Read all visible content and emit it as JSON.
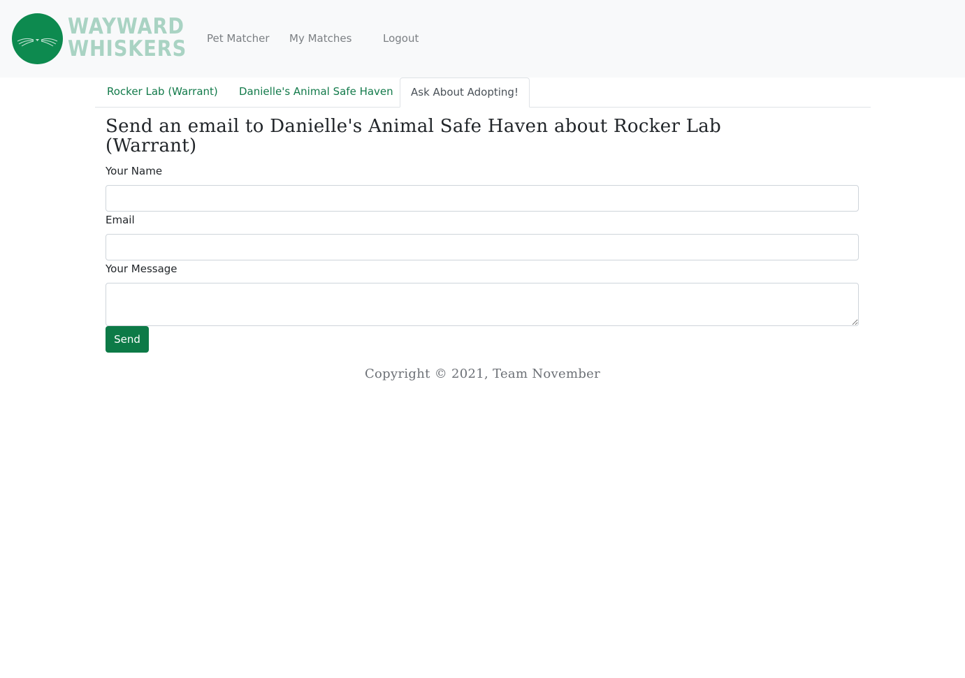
{
  "brand": {
    "logo_line1": "WAYWARD",
    "logo_line2": "WHISKERS",
    "logo_color": "#a9d3c3",
    "circle_color": "#0d8a4f"
  },
  "nav": {
    "links": [
      "Pet Matcher",
      "My Matches",
      "Logout"
    ]
  },
  "tabs": {
    "items": [
      "Rocker Lab (Warrant)",
      "Danielle's Animal Safe Haven",
      "Ask About Adopting!"
    ],
    "active": "Ask About Adopting!"
  },
  "form": {
    "heading": "Send an email to Danielle's Animal Safe Haven about Rocker Lab (Warrant)",
    "name_label": "Your Name",
    "name_value": "",
    "email_label": "Email",
    "email_value": "",
    "message_label": "Your Message",
    "message_value": "",
    "send_label": "Send",
    "accent_color": "#0d7a47"
  },
  "footer": {
    "copyright": "Copyright © 2021, Team November"
  }
}
